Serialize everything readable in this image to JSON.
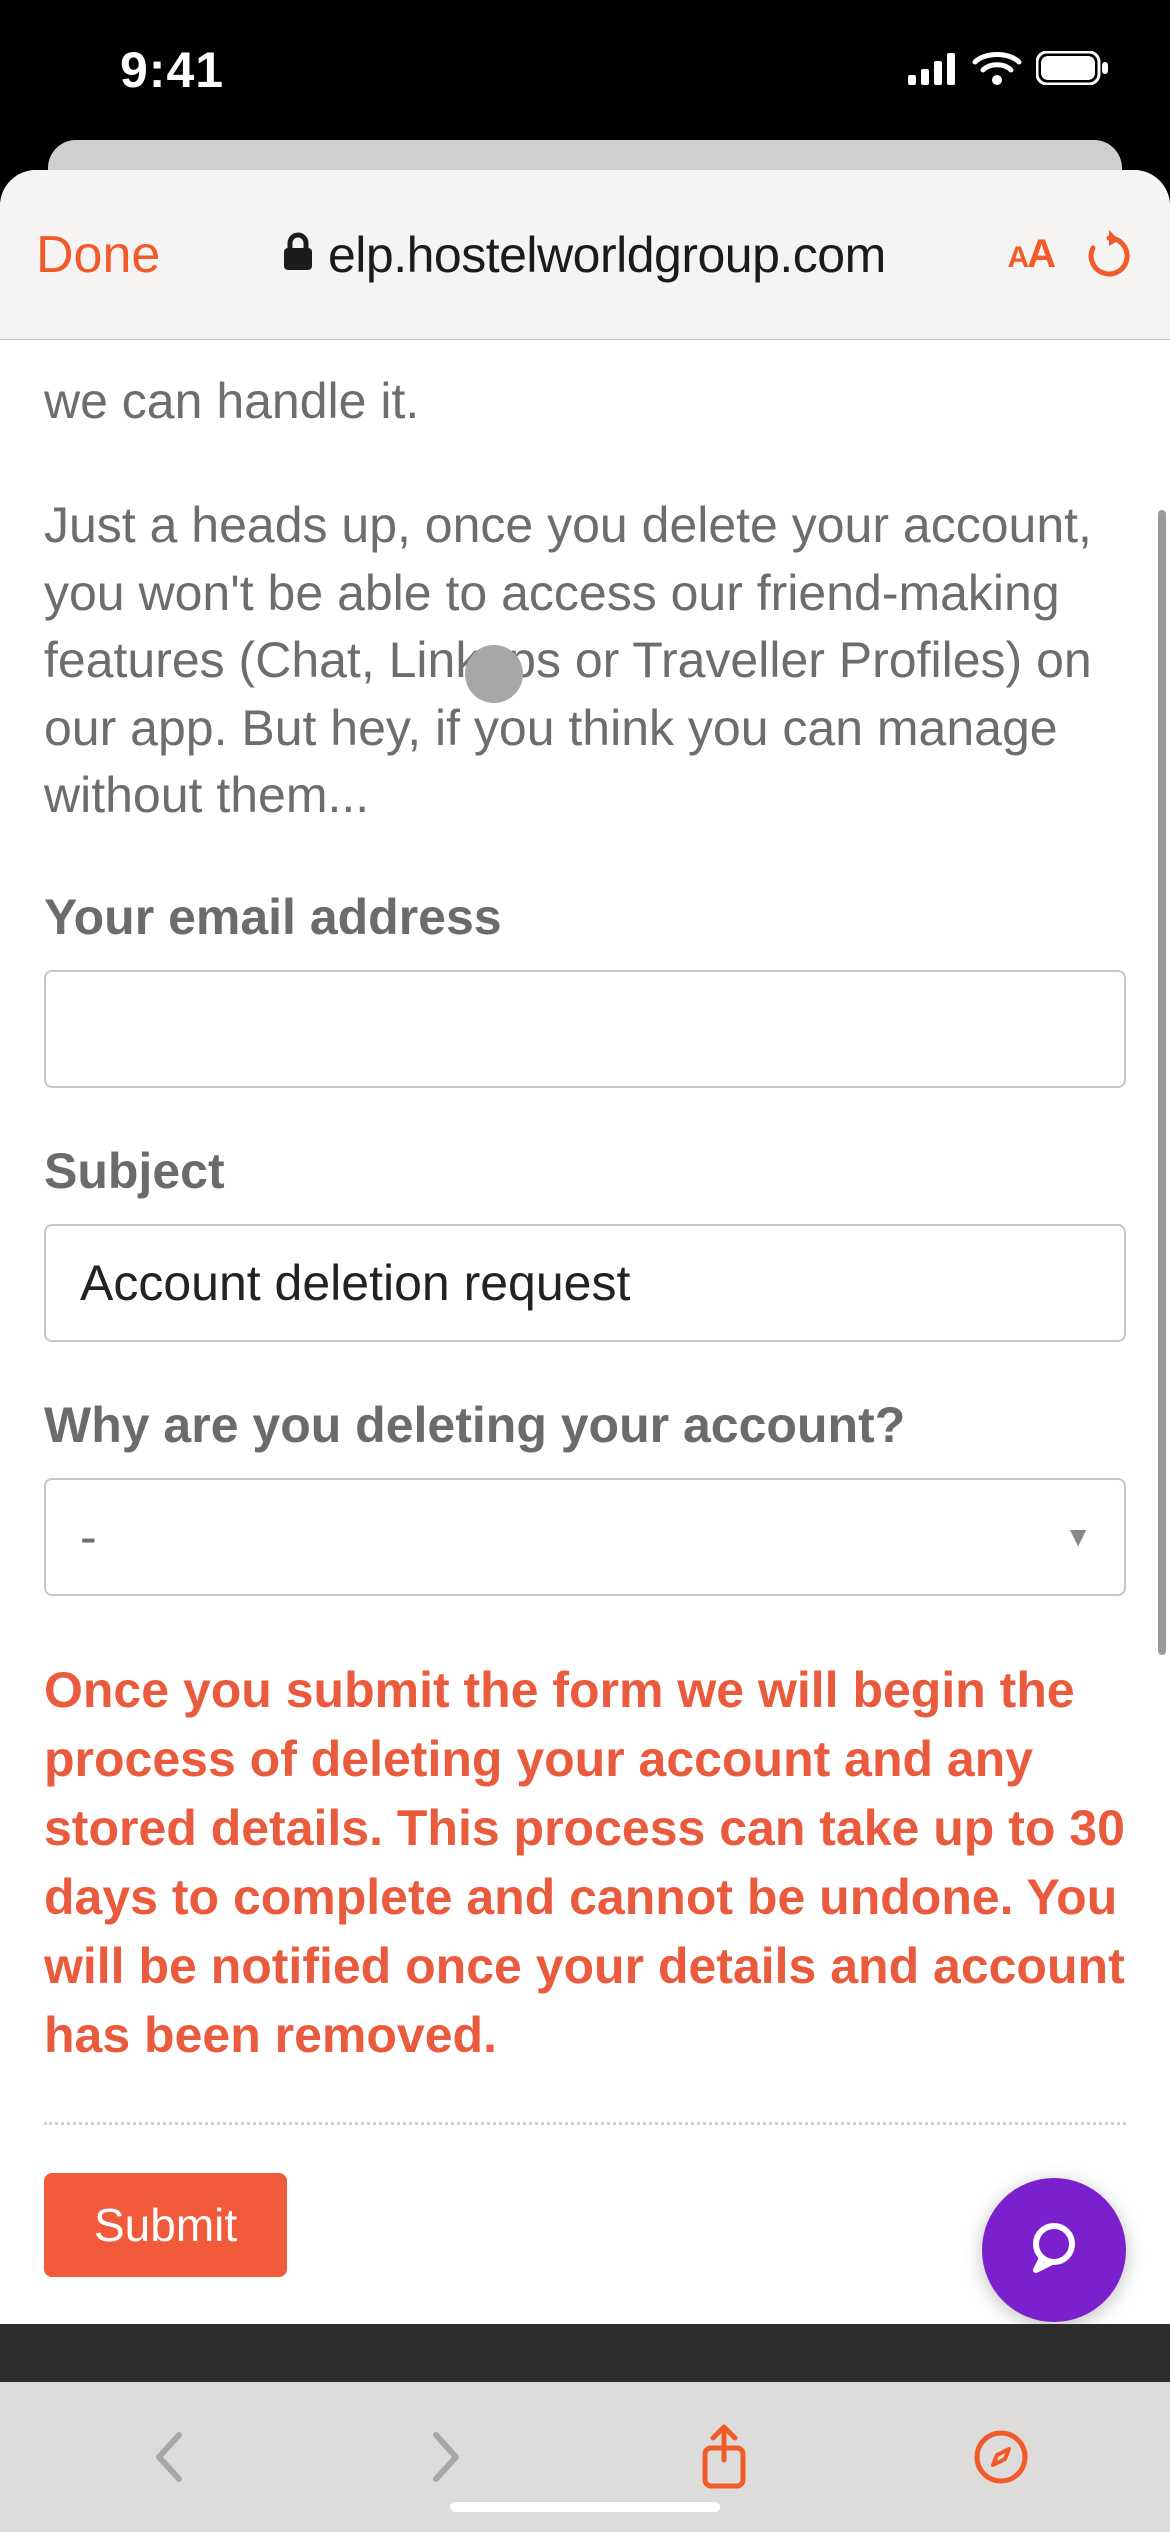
{
  "status_bar": {
    "time": "9:41"
  },
  "browser": {
    "done_label": "Done",
    "domain": "elp.hostelworldgroup.com",
    "aa_small": "A",
    "aa_large": "A"
  },
  "page": {
    "truncated_prev_line": "we can handle it.",
    "heads_up_para": "Just a heads up, once you delete your account, you won't be able to access our friend-making features (Chat, Linkups or Traveller Profiles) on our app. But hey, if you think you can manage without them...",
    "email_label": "Your email address",
    "email_value": "",
    "subject_label": "Subject",
    "subject_value": "Account deletion request",
    "reason_label": "Why are you deleting your account?",
    "reason_selected": "-",
    "warning_text": "Once you submit the form we will begin the process of deleting your account and any stored details. This process can take up to 30 days to complete and cannot be undone. You will be notified once your details and account has been removed.",
    "submit_label": "Submit"
  }
}
